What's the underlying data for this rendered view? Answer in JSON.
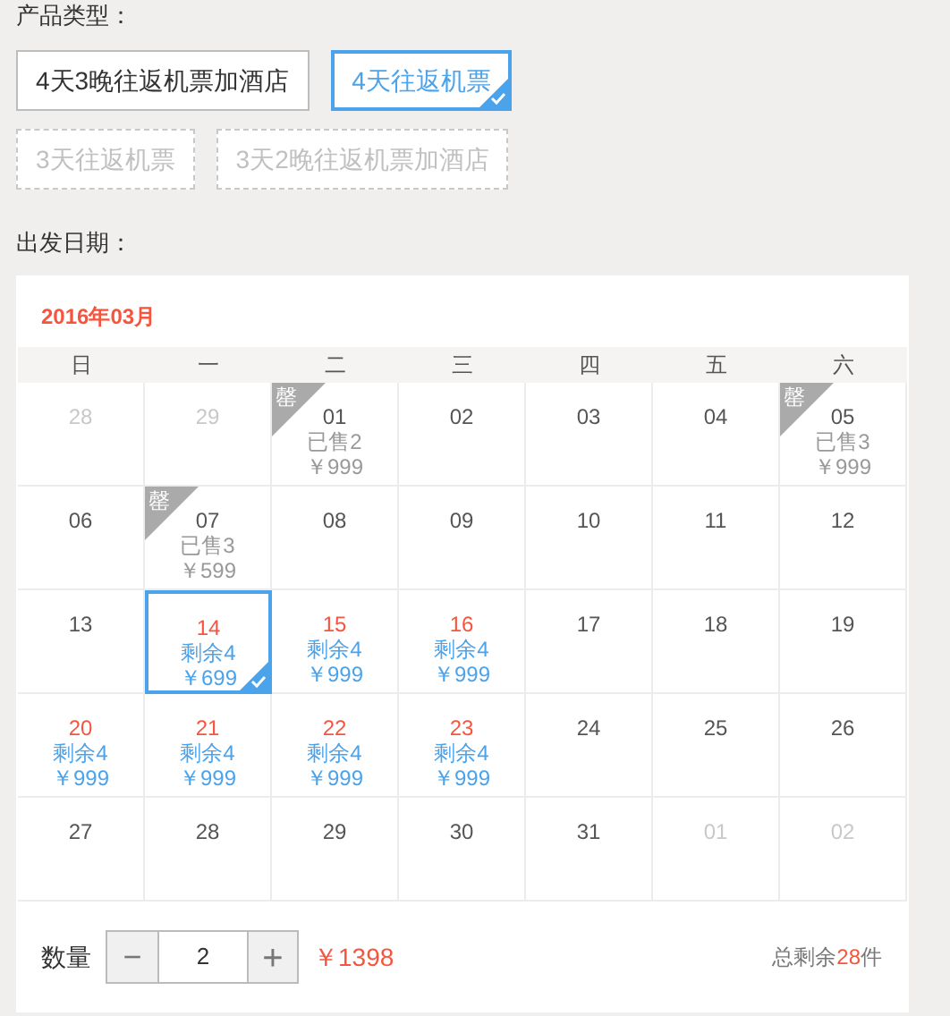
{
  "product_type": {
    "label": "产品类型：",
    "options": [
      {
        "label": "4天3晚往返机票加酒店",
        "available": true,
        "selected": false
      },
      {
        "label": "4天往返机票",
        "available": true,
        "selected": true
      },
      {
        "label": "3天往返机票",
        "available": false,
        "selected": false
      },
      {
        "label": "3天2晚往返机票加酒店",
        "available": false,
        "selected": false
      }
    ]
  },
  "departure": {
    "label": "出发日期：",
    "month": "2016年03月",
    "weekdays": [
      "日",
      "一",
      "二",
      "三",
      "四",
      "五",
      "六"
    ],
    "weeks": [
      [
        {
          "day": "28",
          "kind": "other_month",
          "selected": false
        },
        {
          "day": "29",
          "kind": "other_month",
          "selected": false
        },
        {
          "day": "01",
          "kind": "sold_out",
          "badge": "罄",
          "info": "已售2",
          "price": "￥999",
          "selected": false
        },
        {
          "day": "02",
          "kind": "plain",
          "selected": false
        },
        {
          "day": "03",
          "kind": "plain",
          "selected": false
        },
        {
          "day": "04",
          "kind": "plain",
          "selected": false
        },
        {
          "day": "05",
          "kind": "sold_out",
          "badge": "罄",
          "info": "已售3",
          "price": "￥999",
          "selected": false
        }
      ],
      [
        {
          "day": "06",
          "kind": "plain",
          "selected": false
        },
        {
          "day": "07",
          "kind": "sold_out",
          "badge": "罄",
          "info": "已售3",
          "price": "￥599",
          "selected": false
        },
        {
          "day": "08",
          "kind": "plain",
          "selected": false
        },
        {
          "day": "09",
          "kind": "plain",
          "selected": false
        },
        {
          "day": "10",
          "kind": "plain",
          "selected": false
        },
        {
          "day": "11",
          "kind": "plain",
          "selected": false
        },
        {
          "day": "12",
          "kind": "plain",
          "selected": false
        }
      ],
      [
        {
          "day": "13",
          "kind": "plain",
          "selected": false
        },
        {
          "day": "14",
          "kind": "available",
          "info": "剩余4",
          "price": "￥699",
          "selected": true
        },
        {
          "day": "15",
          "kind": "available",
          "info": "剩余4",
          "price": "￥999",
          "selected": false
        },
        {
          "day": "16",
          "kind": "available",
          "info": "剩余4",
          "price": "￥999",
          "selected": false
        },
        {
          "day": "17",
          "kind": "plain",
          "selected": false
        },
        {
          "day": "18",
          "kind": "plain",
          "selected": false
        },
        {
          "day": "19",
          "kind": "plain",
          "selected": false
        }
      ],
      [
        {
          "day": "20",
          "kind": "available",
          "info": "剩余4",
          "price": "￥999",
          "selected": false
        },
        {
          "day": "21",
          "kind": "available",
          "info": "剩余4",
          "price": "￥999",
          "selected": false
        },
        {
          "day": "22",
          "kind": "available",
          "info": "剩余4",
          "price": "￥999",
          "selected": false
        },
        {
          "day": "23",
          "kind": "available",
          "info": "剩余4",
          "price": "￥999",
          "selected": false
        },
        {
          "day": "24",
          "kind": "plain",
          "selected": false
        },
        {
          "day": "25",
          "kind": "plain",
          "selected": false
        },
        {
          "day": "26",
          "kind": "plain",
          "selected": false
        }
      ],
      [
        {
          "day": "27",
          "kind": "plain",
          "selected": false
        },
        {
          "day": "28",
          "kind": "plain",
          "selected": false
        },
        {
          "day": "29",
          "kind": "plain",
          "selected": false
        },
        {
          "day": "30",
          "kind": "plain",
          "selected": false
        },
        {
          "day": "31",
          "kind": "plain",
          "selected": false
        },
        {
          "day": "01",
          "kind": "other_month",
          "selected": false
        },
        {
          "day": "02",
          "kind": "other_month",
          "selected": false
        }
      ]
    ]
  },
  "quantity": {
    "label": "数量",
    "minus": "−",
    "value": "2",
    "plus": "+",
    "total_price": "￥1398",
    "remaining_label": "总剩余",
    "remaining_count": "28",
    "remaining_unit": "件"
  }
}
